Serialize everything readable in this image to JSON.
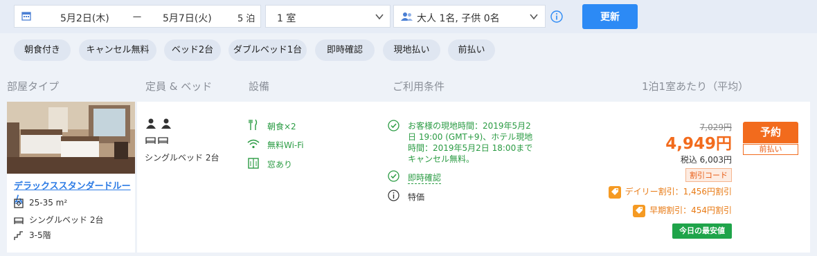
{
  "search": {
    "checkin": "5月2日(木)",
    "dash": "ー",
    "checkout": "5月7日(火)",
    "nights": "5 泊",
    "rooms": "1 室",
    "guests": "大人 1名, 子供 0名",
    "update_label": "更新"
  },
  "filters": [
    "朝食付き",
    "キャンセル無料",
    "ベッド2台",
    "ダブルベッド1台",
    "即時確認",
    "現地払い",
    "前払い"
  ],
  "headers": {
    "room_type": "部屋タイプ",
    "capacity": "定員 & ベッド",
    "facilities": "設備",
    "conditions": "ご利用条件",
    "price": "1泊1室あたり（平均）"
  },
  "room": {
    "name": "デラックススタンダードルーム",
    "size": "25-35 m²",
    "bed": "シングルベッド 2台",
    "floor": "3-5階"
  },
  "offer": {
    "bed_text": "シングルベッド 2台",
    "facilities": [
      "朝食×2",
      "無料Wi-Fi",
      "窓あり"
    ],
    "conditions": {
      "cancel": "お客様の現地時間：2019年5月2日 19:00 (GMT+9)、ホテル現地時間：2019年5月2日 18:00までキャンセル無料。",
      "instant": "即時確認",
      "special": "特価"
    },
    "price_old": "7,029円",
    "price": "4,949円",
    "price_tax": "税込 6,003円",
    "discount_code": "割引コード",
    "daily_discount": "デイリー割引：1,456円割引",
    "early_discount": "早期割引：454円割引",
    "lowest_badge": "今日の最安値",
    "book_label": "予約",
    "prepay_label": "前払い"
  },
  "colors": {
    "accent": "#2c8af5",
    "price": "#f26b1d",
    "green": "#2a9b43",
    "badge_green": "#1fa44a"
  }
}
